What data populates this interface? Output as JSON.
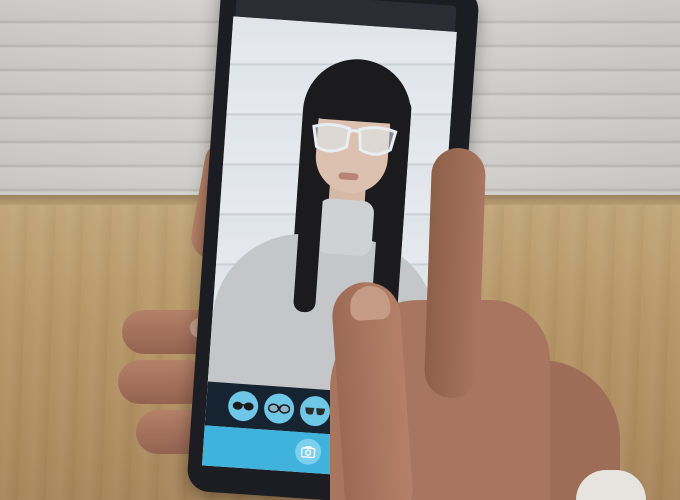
{
  "scene": {
    "description_visible_text": "",
    "colors": {
      "accent_blue": "#3fb3dc",
      "filter_blue": "#6fc7e8",
      "tray_dark": "#162431",
      "phone_body": "#1c1d22"
    }
  },
  "app": {
    "filters": [
      {
        "icon": "sunglasses-icon"
      },
      {
        "icon": "round-glasses-icon"
      },
      {
        "icon": "aviator-glasses-icon"
      },
      {
        "icon": "glasses-partial-icon"
      }
    ],
    "shutter_icon": "camera-icon"
  }
}
